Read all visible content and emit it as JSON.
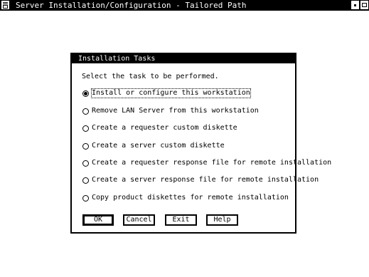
{
  "window": {
    "title": "Server Installation/Configuration - Tailored Path"
  },
  "dialog": {
    "title": "Installation Tasks",
    "instructions": "Select the task to be performed.",
    "options": [
      {
        "label": "Install or configure this workstation",
        "selected": true
      },
      {
        "label": "Remove LAN Server from this workstation",
        "selected": false
      },
      {
        "label": "Create a requester custom diskette",
        "selected": false
      },
      {
        "label": "Create a server custom diskette",
        "selected": false
      },
      {
        "label": "Create a requester response file for remote installation",
        "selected": false
      },
      {
        "label": "Create a server response file for remote installation",
        "selected": false
      },
      {
        "label": "Copy product diskettes for remote installation",
        "selected": false
      }
    ],
    "buttons": {
      "ok": "OK",
      "cancel": "Cancel",
      "exit": "Exit",
      "help": "Help"
    }
  },
  "icons": {
    "system_menu": "system-menu-icon",
    "minimize": "minimize-icon",
    "maximize": "maximize-icon",
    "radio": "radio-button-icon"
  }
}
